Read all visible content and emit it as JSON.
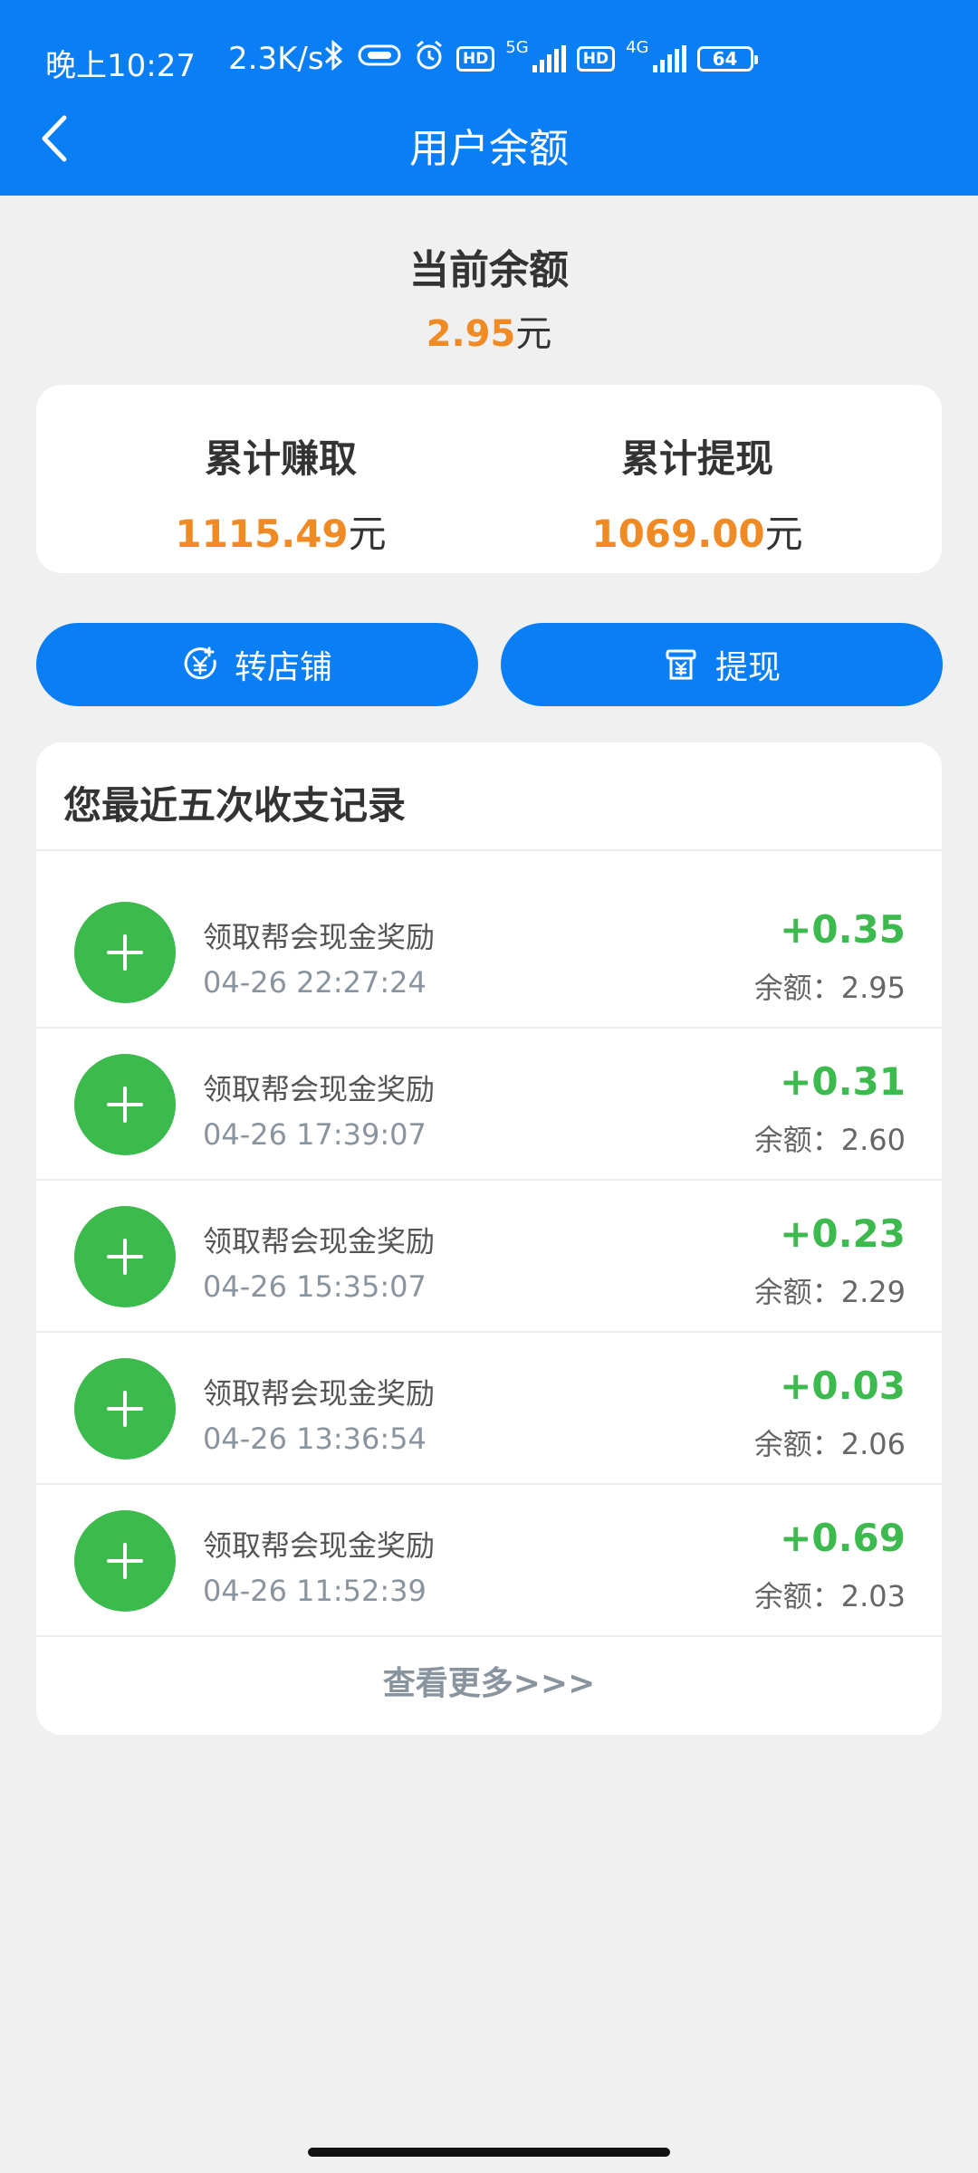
{
  "status_bar": {
    "time": "晚上10:27",
    "speed": "2.3K/s",
    "hd1": "HD",
    "net1": "5G",
    "hd2": "HD",
    "net2": "4G",
    "battery": "64"
  },
  "header": {
    "title": "用户余额"
  },
  "balance": {
    "title": "当前余额",
    "amount": "2.95",
    "unit": "元"
  },
  "stats": {
    "earned_label": "累计赚取",
    "earned_value": "1115.49",
    "withdrawn_label": "累计提现",
    "withdrawn_value": "1069.00",
    "unit": "元"
  },
  "actions": {
    "transfer_label": "转店铺",
    "withdraw_label": "提现"
  },
  "records": {
    "title": "您最近五次收支记录",
    "items": [
      {
        "desc": "领取帮会现金奖励",
        "time": "04-26 22:27:24",
        "amount": "+0.35",
        "balance": "余额：2.95"
      },
      {
        "desc": "领取帮会现金奖励",
        "time": "04-26 17:39:07",
        "amount": "+0.31",
        "balance": "余额：2.60"
      },
      {
        "desc": "领取帮会现金奖励",
        "time": "04-26 15:35:07",
        "amount": "+0.23",
        "balance": "余额：2.29"
      },
      {
        "desc": "领取帮会现金奖励",
        "time": "04-26 13:36:54",
        "amount": "+0.03",
        "balance": "余额：2.06"
      },
      {
        "desc": "领取帮会现金奖励",
        "time": "04-26 11:52:39",
        "amount": "+0.69",
        "balance": "余额：2.03"
      }
    ],
    "view_more": "查看更多>>>"
  },
  "colors": {
    "primary": "#0a7ef5",
    "accent_orange": "#f08a24",
    "income_green": "#3dba4e"
  },
  "icons": {
    "back": "chevron-left-icon",
    "transfer": "yen-coin-icon",
    "withdraw": "wallet-icon",
    "record": "plus-icon"
  }
}
